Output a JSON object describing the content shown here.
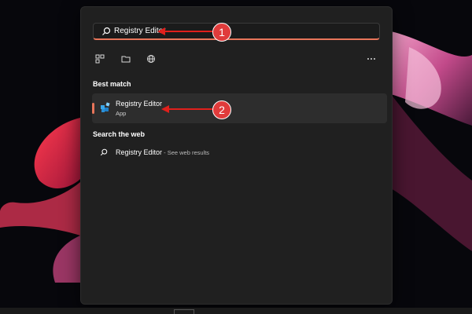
{
  "search": {
    "value": "Registry Editor"
  },
  "filters": [
    {
      "icon": "apps-icon"
    },
    {
      "icon": "folder-icon"
    },
    {
      "icon": "globe-icon"
    },
    {
      "icon": "more-icon"
    }
  ],
  "best_match": {
    "heading": "Best match",
    "item": {
      "name": "Registry Editor",
      "type": "App",
      "icon": "registry-editor-icon"
    }
  },
  "web": {
    "heading": "Search the web",
    "item": {
      "query": "Registry Editor",
      "suffix": " - See web results"
    }
  },
  "callouts": [
    "1",
    "2"
  ],
  "colors": {
    "accent": "#e8755a",
    "panel": "#202020",
    "callout": "#e03b3b",
    "arrow": "#e0201c"
  }
}
